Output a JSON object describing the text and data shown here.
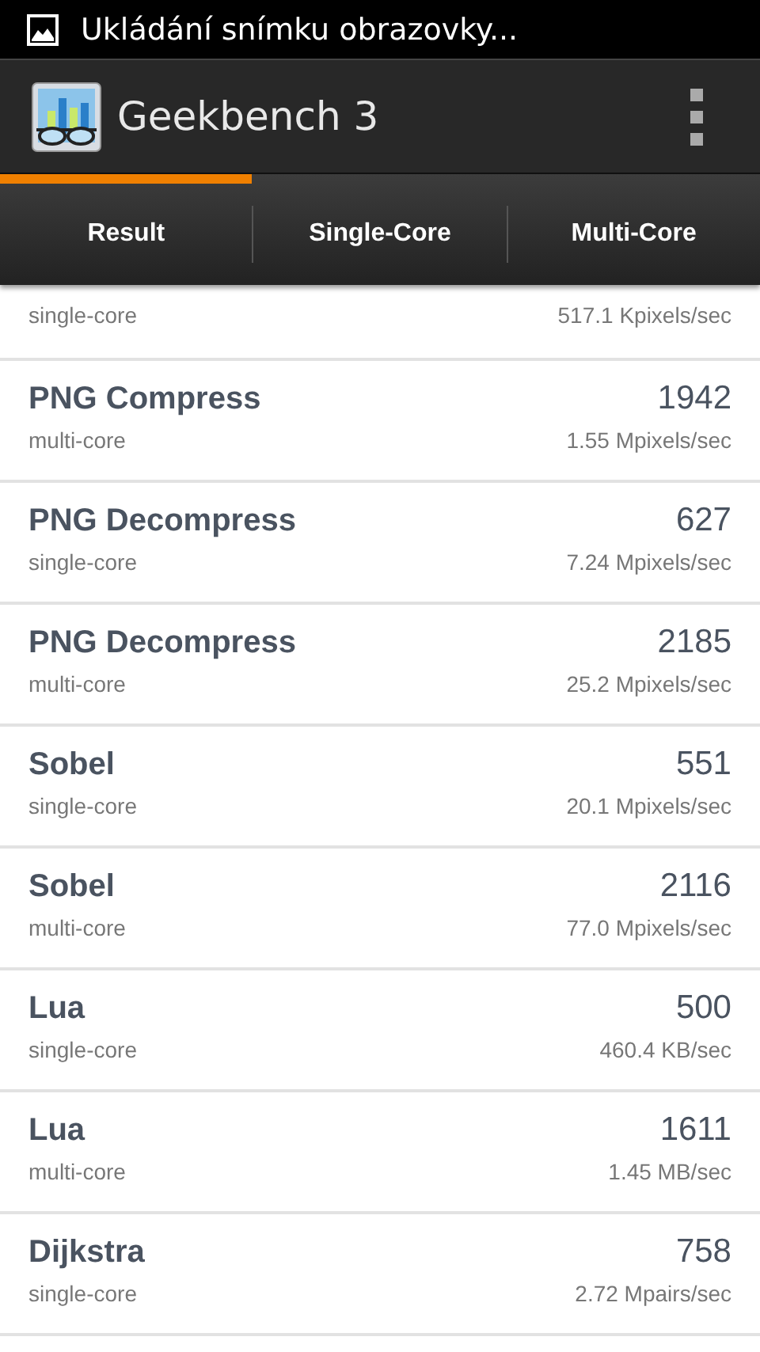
{
  "status_bar": {
    "notification": "Ukládání snímku obrazovky..."
  },
  "app_bar": {
    "title": "Geekbench 3"
  },
  "tabs": [
    {
      "label": "Result",
      "selected": true
    },
    {
      "label": "Single-Core",
      "selected": false
    },
    {
      "label": "Multi-Core",
      "selected": false
    }
  ],
  "results": [
    {
      "mode": "single-core",
      "rate": "517.1 Kpixels/sec"
    },
    {
      "name": "PNG Compress",
      "score": "1942",
      "mode": "multi-core",
      "rate": "1.55 Mpixels/sec"
    },
    {
      "name": "PNG Decompress",
      "score": "627",
      "mode": "single-core",
      "rate": "7.24 Mpixels/sec"
    },
    {
      "name": "PNG Decompress",
      "score": "2185",
      "mode": "multi-core",
      "rate": "25.2 Mpixels/sec"
    },
    {
      "name": "Sobel",
      "score": "551",
      "mode": "single-core",
      "rate": "20.1 Mpixels/sec"
    },
    {
      "name": "Sobel",
      "score": "2116",
      "mode": "multi-core",
      "rate": "77.0 Mpixels/sec"
    },
    {
      "name": "Lua",
      "score": "500",
      "mode": "single-core",
      "rate": "460.4 KB/sec"
    },
    {
      "name": "Lua",
      "score": "1611",
      "mode": "multi-core",
      "rate": "1.45 MB/sec"
    },
    {
      "name": "Dijkstra",
      "score": "758",
      "mode": "single-core",
      "rate": "2.72 Mpairs/sec"
    }
  ]
}
